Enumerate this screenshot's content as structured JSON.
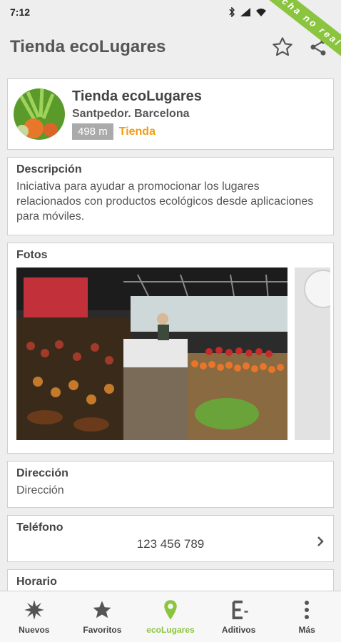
{
  "status_bar": {
    "time": "7:12",
    "ribbon": "Ficha no real"
  },
  "app_bar": {
    "title": "Tienda ecoLugares"
  },
  "place": {
    "name": "Tienda ecoLugares",
    "location": "Santpedor. Barcelona",
    "distance": "498 m",
    "category": "Tienda"
  },
  "description": {
    "label": "Descripción",
    "text": "Iniciativa para ayudar a promocionar los lugares relacionados con productos ecológicos desde aplicaciones para móviles."
  },
  "photos": {
    "label": "Fotos"
  },
  "address": {
    "label": "Dirección",
    "value": "Dirección"
  },
  "phone": {
    "label": "Teléfono",
    "value": "123 456 789"
  },
  "hours": {
    "label": "Horario"
  },
  "bottom_nav": {
    "items": [
      {
        "label": "Nuevos",
        "icon": "burst-icon"
      },
      {
        "label": "Favoritos",
        "icon": "star-icon"
      },
      {
        "label": "ecoLugares",
        "icon": "location-pin-icon"
      },
      {
        "label": "Aditivos",
        "icon": "e-number-icon"
      },
      {
        "label": "Más",
        "icon": "more-vertical-icon"
      }
    ],
    "active_index": 2
  },
  "colors": {
    "accent": "#8bc53f",
    "category": "#f39c12",
    "background": "#eeeeee"
  }
}
